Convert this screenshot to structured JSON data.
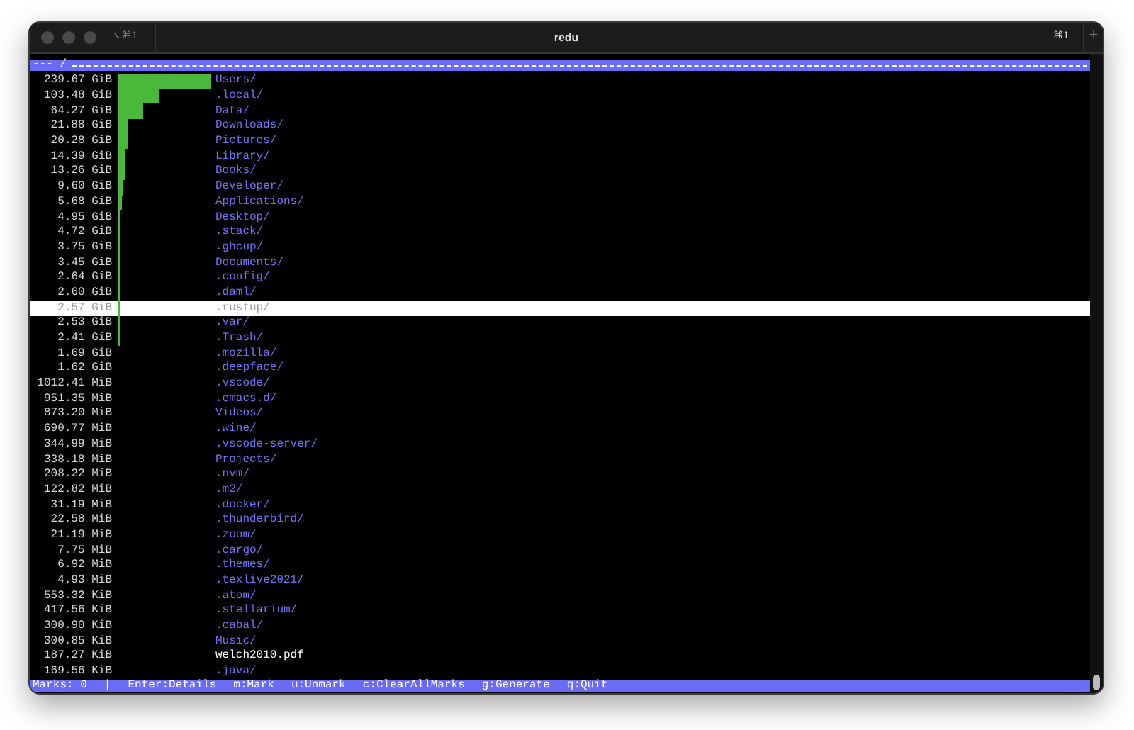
{
  "window": {
    "title": "redu",
    "tab_shortcut": "⌥⌘1",
    "window_shortcut": "⌘1",
    "new_tab": "+"
  },
  "header": {
    "path": "--- /"
  },
  "rows": [
    {
      "size": "239.67 GiB",
      "name": "Users/",
      "kind": "dir",
      "level": 1,
      "selected": false
    },
    {
      "size": "103.48 GiB",
      "name": ".local/",
      "kind": "dir",
      "level": 0.432,
      "selected": false
    },
    {
      "size": "64.27 GiB",
      "name": "Data/",
      "kind": "dir",
      "level": 0.268,
      "selected": false
    },
    {
      "size": "21.88 GiB",
      "name": "Downloads/",
      "kind": "dir",
      "level": 0.091,
      "selected": false
    },
    {
      "size": "20.28 GiB",
      "name": "Pictures/",
      "kind": "dir",
      "level": 0.085,
      "selected": false
    },
    {
      "size": "14.39 GiB",
      "name": "Library/",
      "kind": "dir",
      "level": 0.06,
      "selected": false
    },
    {
      "size": "13.26 GiB",
      "name": "Books/",
      "kind": "dir",
      "level": 0.055,
      "selected": false
    },
    {
      "size": "9.60 GiB",
      "name": "Developer/",
      "kind": "dir",
      "level": 0.04,
      "selected": false
    },
    {
      "size": "5.68 GiB",
      "name": "Applications/",
      "kind": "dir",
      "level": 0.024,
      "selected": false
    },
    {
      "size": "4.95 GiB",
      "name": "Desktop/",
      "kind": "dir",
      "level": 0.021,
      "selected": false
    },
    {
      "size": "4.72 GiB",
      "name": ".stack/",
      "kind": "dir",
      "level": 0.02,
      "selected": false
    },
    {
      "size": "3.75 GiB",
      "name": ".ghcup/",
      "kind": "dir",
      "level": 0.016,
      "selected": false
    },
    {
      "size": "3.45 GiB",
      "name": "Documents/",
      "kind": "dir",
      "level": 0.014,
      "selected": false
    },
    {
      "size": "2.64 GiB",
      "name": ".config/",
      "kind": "dir",
      "level": 0.011,
      "selected": false
    },
    {
      "size": "2.60 GiB",
      "name": ".daml/",
      "kind": "dir",
      "level": 0.011,
      "selected": false
    },
    {
      "size": "2.57 GiB",
      "name": ".rustup/",
      "kind": "dir",
      "level": 0.011,
      "selected": true
    },
    {
      "size": "2.53 GiB",
      "name": ".var/",
      "kind": "dir",
      "level": 0.011,
      "selected": false
    },
    {
      "size": "2.41 GiB",
      "name": ".Trash/",
      "kind": "dir",
      "level": 0.01,
      "selected": false
    },
    {
      "size": "1.69 GiB",
      "name": ".mozilla/",
      "kind": "dir",
      "selected": false
    },
    {
      "size": "1.62 GiB",
      "name": ".deepface/",
      "kind": "dir",
      "selected": false
    },
    {
      "size": "1012.41 MiB",
      "name": ".vscode/",
      "kind": "dir",
      "selected": false
    },
    {
      "size": "951.35 MiB",
      "name": ".emacs.d/",
      "kind": "dir",
      "selected": false
    },
    {
      "size": "873.20 MiB",
      "name": "Videos/",
      "kind": "dir",
      "selected": false
    },
    {
      "size": "690.77 MiB",
      "name": ".wine/",
      "kind": "dir",
      "selected": false
    },
    {
      "size": "344.99 MiB",
      "name": ".vscode-server/",
      "kind": "dir",
      "selected": false
    },
    {
      "size": "338.18 MiB",
      "name": "Projects/",
      "kind": "dir",
      "selected": false
    },
    {
      "size": "208.22 MiB",
      "name": ".nvm/",
      "kind": "dir",
      "selected": false
    },
    {
      "size": "122.82 MiB",
      "name": ".m2/",
      "kind": "dir",
      "selected": false
    },
    {
      "size": "31.19 MiB",
      "name": ".docker/",
      "kind": "dir",
      "selected": false
    },
    {
      "size": "22.58 MiB",
      "name": ".thunderbird/",
      "kind": "dir",
      "selected": false
    },
    {
      "size": "21.19 MiB",
      "name": ".zoom/",
      "kind": "dir",
      "selected": false
    },
    {
      "size": "7.75 MiB",
      "name": ".cargo/",
      "kind": "dir",
      "selected": false
    },
    {
      "size": "6.92 MiB",
      "name": ".themes/",
      "kind": "dir",
      "selected": false
    },
    {
      "size": "4.93 MiB",
      "name": ".texlive2021/",
      "kind": "dir",
      "selected": false
    },
    {
      "size": "553.32 KiB",
      "name": ".atom/",
      "kind": "dir",
      "selected": false
    },
    {
      "size": "417.56 KiB",
      "name": ".stellarium/",
      "kind": "dir",
      "selected": false
    },
    {
      "size": "300.90 KiB",
      "name": ".cabal/",
      "kind": "dir",
      "selected": false
    },
    {
      "size": "300.85 KiB",
      "name": "Music/",
      "kind": "dir",
      "selected": false
    },
    {
      "size": "187.27 KiB",
      "name": "welch2010.pdf",
      "kind": "file",
      "selected": false
    },
    {
      "size": "169.56 KiB",
      "name": ".java/",
      "kind": "dir",
      "selected": false
    }
  ],
  "status_bar": {
    "marks": "Marks: 0",
    "separator": "|",
    "hints": [
      "Enter:Details",
      "m:Mark",
      "u:Unmark",
      "c:ClearAllMarks",
      "g:Generate",
      "q:Quit"
    ]
  }
}
